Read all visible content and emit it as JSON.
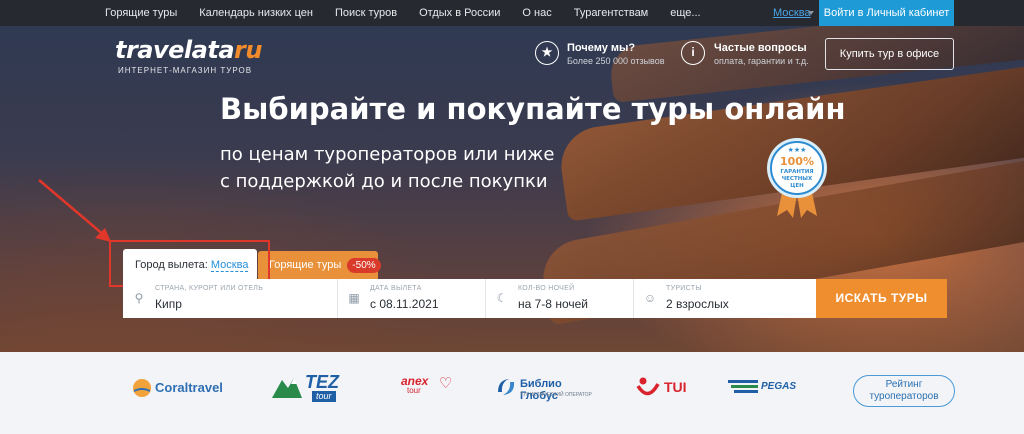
{
  "topnav": {
    "links": [
      "Горящие туры",
      "Календарь низких цен",
      "Поиск туров",
      "Отдых в России",
      "О нас",
      "Турагентствам",
      "еще..."
    ],
    "city": "Москва",
    "login_label": "Войти в Личный кабинет"
  },
  "header": {
    "logo_text": "travelata",
    "logo_ru": "ru",
    "logo_sub": "ИНТЕРНЕТ-МАГАЗИН ТУРОВ",
    "why_title": "Почему мы?",
    "why_sub": "Более 250 000 отзывов",
    "faq_title": "Частые вопросы",
    "faq_sub": "оплата, гарантии и т.д.",
    "office_button": "Купить тур в офисе"
  },
  "hero": {
    "title": "Выбирайте и покупайте туры онлайн",
    "subtitle_line1": "по ценам туроператоров или ниже",
    "subtitle_line2": "с поддержкой до и после покупки",
    "badge_pct": "100%",
    "badge_line1": "ГАРАНТИЯ",
    "badge_line2": "ЧЕСТНЫХ",
    "badge_line3": "ЦЕН"
  },
  "tabs": {
    "city_prefix": "Город вылета:",
    "city_value": "Москва",
    "hot_label": "Горящие туры",
    "hot_discount": "-50%"
  },
  "search": {
    "destination_label": "СТРАНА, КУРОРТ ИЛИ ОТЕЛЬ",
    "destination_value": "Кипр",
    "date_label": "ДАТА ВЫЛЕТА",
    "date_value": "с 08.11.2021",
    "nights_label": "КОЛ-ВО НОЧЕЙ",
    "nights_value": "на 7-8 ночей",
    "tourists_label": "ТУРИСТЫ",
    "tourists_value": "2 взрослых",
    "button_label": "ИСКАТЬ ТУРЫ"
  },
  "partners": {
    "coral": "Coraltravel",
    "tez": "TEZ",
    "tez_sub": "tour",
    "anex": "anex",
    "anex_sub": "tour",
    "biblio": "Библио Глобус",
    "biblio_sub": "ТУРИСТИЧЕСКИЙ ОПЕРАТОР",
    "tui": "TUI",
    "pegas": "PEGAS",
    "rating_line1": "Рейтинг",
    "rating_line2": "туроператоров"
  },
  "colors": {
    "accent_orange": "#ef8e2f",
    "link_blue": "#2590d8",
    "annotation_red": "#e1362a"
  }
}
